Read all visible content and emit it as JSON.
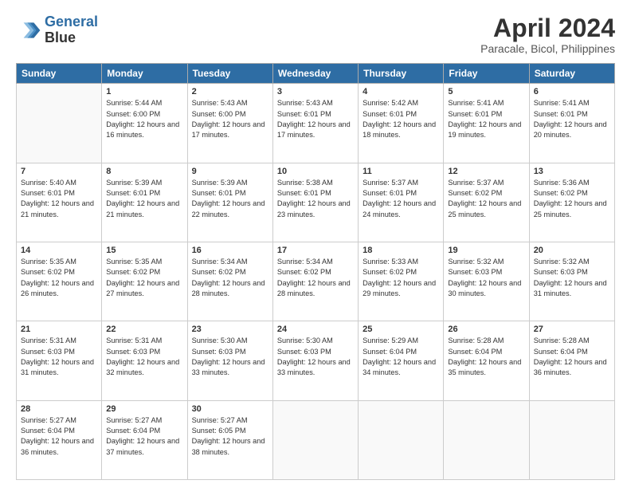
{
  "header": {
    "logo_line1": "General",
    "logo_line2": "Blue",
    "month_title": "April 2024",
    "subtitle": "Paracale, Bicol, Philippines"
  },
  "weekdays": [
    "Sunday",
    "Monday",
    "Tuesday",
    "Wednesday",
    "Thursday",
    "Friday",
    "Saturday"
  ],
  "weeks": [
    [
      {
        "day": "",
        "sunrise": "",
        "sunset": "",
        "daylight": ""
      },
      {
        "day": "1",
        "sunrise": "Sunrise: 5:44 AM",
        "sunset": "Sunset: 6:00 PM",
        "daylight": "Daylight: 12 hours and 16 minutes."
      },
      {
        "day": "2",
        "sunrise": "Sunrise: 5:43 AM",
        "sunset": "Sunset: 6:00 PM",
        "daylight": "Daylight: 12 hours and 17 minutes."
      },
      {
        "day": "3",
        "sunrise": "Sunrise: 5:43 AM",
        "sunset": "Sunset: 6:01 PM",
        "daylight": "Daylight: 12 hours and 17 minutes."
      },
      {
        "day": "4",
        "sunrise": "Sunrise: 5:42 AM",
        "sunset": "Sunset: 6:01 PM",
        "daylight": "Daylight: 12 hours and 18 minutes."
      },
      {
        "day": "5",
        "sunrise": "Sunrise: 5:41 AM",
        "sunset": "Sunset: 6:01 PM",
        "daylight": "Daylight: 12 hours and 19 minutes."
      },
      {
        "day": "6",
        "sunrise": "Sunrise: 5:41 AM",
        "sunset": "Sunset: 6:01 PM",
        "daylight": "Daylight: 12 hours and 20 minutes."
      }
    ],
    [
      {
        "day": "7",
        "sunrise": "Sunrise: 5:40 AM",
        "sunset": "Sunset: 6:01 PM",
        "daylight": "Daylight: 12 hours and 21 minutes."
      },
      {
        "day": "8",
        "sunrise": "Sunrise: 5:39 AM",
        "sunset": "Sunset: 6:01 PM",
        "daylight": "Daylight: 12 hours and 21 minutes."
      },
      {
        "day": "9",
        "sunrise": "Sunrise: 5:39 AM",
        "sunset": "Sunset: 6:01 PM",
        "daylight": "Daylight: 12 hours and 22 minutes."
      },
      {
        "day": "10",
        "sunrise": "Sunrise: 5:38 AM",
        "sunset": "Sunset: 6:01 PM",
        "daylight": "Daylight: 12 hours and 23 minutes."
      },
      {
        "day": "11",
        "sunrise": "Sunrise: 5:37 AM",
        "sunset": "Sunset: 6:01 PM",
        "daylight": "Daylight: 12 hours and 24 minutes."
      },
      {
        "day": "12",
        "sunrise": "Sunrise: 5:37 AM",
        "sunset": "Sunset: 6:02 PM",
        "daylight": "Daylight: 12 hours and 25 minutes."
      },
      {
        "day": "13",
        "sunrise": "Sunrise: 5:36 AM",
        "sunset": "Sunset: 6:02 PM",
        "daylight": "Daylight: 12 hours and 25 minutes."
      }
    ],
    [
      {
        "day": "14",
        "sunrise": "Sunrise: 5:35 AM",
        "sunset": "Sunset: 6:02 PM",
        "daylight": "Daylight: 12 hours and 26 minutes."
      },
      {
        "day": "15",
        "sunrise": "Sunrise: 5:35 AM",
        "sunset": "Sunset: 6:02 PM",
        "daylight": "Daylight: 12 hours and 27 minutes."
      },
      {
        "day": "16",
        "sunrise": "Sunrise: 5:34 AM",
        "sunset": "Sunset: 6:02 PM",
        "daylight": "Daylight: 12 hours and 28 minutes."
      },
      {
        "day": "17",
        "sunrise": "Sunrise: 5:34 AM",
        "sunset": "Sunset: 6:02 PM",
        "daylight": "Daylight: 12 hours and 28 minutes."
      },
      {
        "day": "18",
        "sunrise": "Sunrise: 5:33 AM",
        "sunset": "Sunset: 6:02 PM",
        "daylight": "Daylight: 12 hours and 29 minutes."
      },
      {
        "day": "19",
        "sunrise": "Sunrise: 5:32 AM",
        "sunset": "Sunset: 6:03 PM",
        "daylight": "Daylight: 12 hours and 30 minutes."
      },
      {
        "day": "20",
        "sunrise": "Sunrise: 5:32 AM",
        "sunset": "Sunset: 6:03 PM",
        "daylight": "Daylight: 12 hours and 31 minutes."
      }
    ],
    [
      {
        "day": "21",
        "sunrise": "Sunrise: 5:31 AM",
        "sunset": "Sunset: 6:03 PM",
        "daylight": "Daylight: 12 hours and 31 minutes."
      },
      {
        "day": "22",
        "sunrise": "Sunrise: 5:31 AM",
        "sunset": "Sunset: 6:03 PM",
        "daylight": "Daylight: 12 hours and 32 minutes."
      },
      {
        "day": "23",
        "sunrise": "Sunrise: 5:30 AM",
        "sunset": "Sunset: 6:03 PM",
        "daylight": "Daylight: 12 hours and 33 minutes."
      },
      {
        "day": "24",
        "sunrise": "Sunrise: 5:30 AM",
        "sunset": "Sunset: 6:03 PM",
        "daylight": "Daylight: 12 hours and 33 minutes."
      },
      {
        "day": "25",
        "sunrise": "Sunrise: 5:29 AM",
        "sunset": "Sunset: 6:04 PM",
        "daylight": "Daylight: 12 hours and 34 minutes."
      },
      {
        "day": "26",
        "sunrise": "Sunrise: 5:28 AM",
        "sunset": "Sunset: 6:04 PM",
        "daylight": "Daylight: 12 hours and 35 minutes."
      },
      {
        "day": "27",
        "sunrise": "Sunrise: 5:28 AM",
        "sunset": "Sunset: 6:04 PM",
        "daylight": "Daylight: 12 hours and 36 minutes."
      }
    ],
    [
      {
        "day": "28",
        "sunrise": "Sunrise: 5:27 AM",
        "sunset": "Sunset: 6:04 PM",
        "daylight": "Daylight: 12 hours and 36 minutes."
      },
      {
        "day": "29",
        "sunrise": "Sunrise: 5:27 AM",
        "sunset": "Sunset: 6:04 PM",
        "daylight": "Daylight: 12 hours and 37 minutes."
      },
      {
        "day": "30",
        "sunrise": "Sunrise: 5:27 AM",
        "sunset": "Sunset: 6:05 PM",
        "daylight": "Daylight: 12 hours and 38 minutes."
      },
      {
        "day": "",
        "sunrise": "",
        "sunset": "",
        "daylight": ""
      },
      {
        "day": "",
        "sunrise": "",
        "sunset": "",
        "daylight": ""
      },
      {
        "day": "",
        "sunrise": "",
        "sunset": "",
        "daylight": ""
      },
      {
        "day": "",
        "sunrise": "",
        "sunset": "",
        "daylight": ""
      }
    ]
  ]
}
